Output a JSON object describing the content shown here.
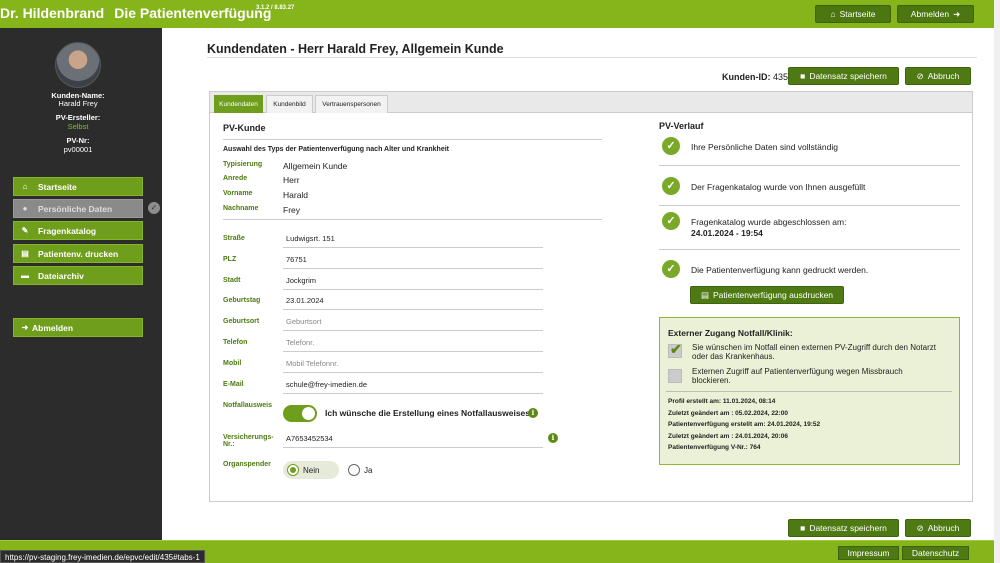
{
  "header": {
    "brand_name": "Dr. Hildenbrand",
    "app_title": "Die Patientenverfügung",
    "version": "3.1.2 / 8.83.27",
    "startseite_label": "Startseite",
    "abmelden_label": "Abmelden"
  },
  "sidebar": {
    "kunden_name_label": "Kunden-Name:",
    "kunden_name": "Harald Frey",
    "pv_ersteller_label": "PV-Ersteller:",
    "pv_ersteller": "Selbst",
    "pv_nr_label": "PV-Nr:",
    "pv_nr": "pv00001",
    "nav": [
      {
        "label": "Startseite",
        "icon": "home-icon"
      },
      {
        "label": "Persönliche Daten",
        "icon": "user-icon"
      },
      {
        "label": "Fragenkatalog",
        "icon": "edit-icon"
      },
      {
        "label": "Patientenv. drucken",
        "icon": "print-icon"
      },
      {
        "label": "Dateiarchiv",
        "icon": "folder-icon"
      }
    ],
    "logout_label": "Abmelden"
  },
  "main": {
    "title": "Kundendaten - Herr Harald Frey, Allgemein Kunde",
    "kunden_id_label": "Kunden-ID:",
    "kunden_id": "435",
    "save_label": "Datensatz speichern",
    "cancel_label": "Abbruch",
    "tabs": [
      "Kundendaten",
      "Kundenbild",
      "Vertrauenspersonen"
    ]
  },
  "pv_kunde": {
    "heading": "PV-Kunde",
    "subheading": "Auswahl des Typs der Patientenverfügung nach Alter und Krankheit",
    "typ_label": "Typisierung",
    "typ": "Allgemein Kunde",
    "anrede_label": "Anrede",
    "anrede": "Herr",
    "vorname_label": "Vorname",
    "vorname": "Harald",
    "nachname_label": "Nachname",
    "nachname": "Frey"
  },
  "form": {
    "strasse_label": "Straße",
    "strasse": "Ludwigsrt. 151",
    "plz_label": "PLZ",
    "plz": "76751",
    "stadt_label": "Stadt",
    "stadt": "Jockgrim",
    "geburtstag_label": "Geburtstag",
    "geburtstag": "23.01.2024",
    "geburtsort_label": "Geburtsort",
    "geburtsort_ph": "Geburtsort",
    "telefon_label": "Telefon",
    "telefon_ph": "Telefonr.",
    "mobil_label": "Mobil",
    "mobil_ph": "Mobil Telefonnr.",
    "email_label": "E-Mail",
    "email": "schule@frey-imedien.de",
    "notfall_label": "Notfallausweis",
    "notfall_text": "Ich wünsche die Erstellung eines Notfallausweises",
    "versicherung_label_1": "Versicherungs-",
    "versicherung_label_2": "Nr.:",
    "versicherung": "A7653452534",
    "organspender_label": "Organspender",
    "nein": "Nein",
    "ja": "Ja"
  },
  "verlauf": {
    "heading": "PV-Verlauf",
    "items": [
      "Ihre Persönliche Daten sind vollständig",
      "Der Fragenkatalog wurde von Ihnen ausgefüllt",
      "Fragenkatalog wurde abgeschlossen am:",
      "Die Patientenverfügung kann gedruckt werden."
    ],
    "abgeschlossen_datum": "24.01.2024 - 19:54",
    "print_button": "Patientenverfügung ausdrucken"
  },
  "extern": {
    "heading": "Externer Zugang Notfall/Klinik:",
    "opt1_line1": "Sie wünschen im Notfall einen externen PV-Zugriff durch den Notarzt",
    "opt1_line2": "oder das Krankenhaus.",
    "opt2_line1": "Externen Zugriff auf Patientenverfügung wegen Missbrauch",
    "opt2_line2": "blockieren.",
    "meta": [
      "Profil erstellt am: 11.01.2024, 08:14",
      "Zuletzt geändert am : 05.02.2024, 22:00",
      "Patientenverfügung erstellt am: 24.01.2024, 19:52",
      "Zuletzt geändert am : 24.01.2024, 20:06",
      "Patientenverfügung V-Nr.: 764"
    ]
  },
  "footer": {
    "impressum": "Impressum",
    "datenschutz": "Datenschutz",
    "status_url": "https://pv-staging.frey-imedien.de/epvc/edit/435#tabs-1"
  }
}
